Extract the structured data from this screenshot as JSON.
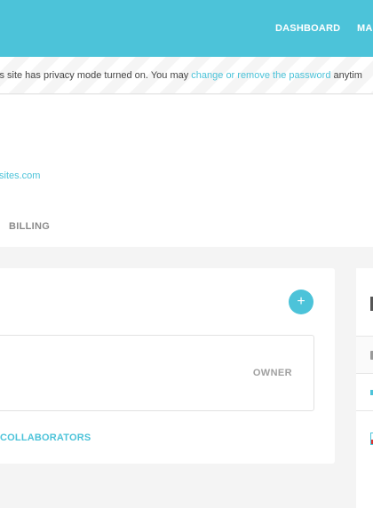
{
  "topnav": {
    "dashboard": "DASHBOARD",
    "more": "MA"
  },
  "privacy": {
    "text_before": "is site has privacy mode turned on. You may ",
    "link": "change or remove the password",
    "text_after": " anytim"
  },
  "site": {
    "url": "sites.com"
  },
  "tabs": {
    "billing": "BILLING"
  },
  "members": {
    "add_label": "+",
    "role": "OWNER",
    "collaborators_link": "COLLABORATORS"
  },
  "colors": {
    "accent": "#4cc3d9",
    "background": "#f4f4f4"
  }
}
